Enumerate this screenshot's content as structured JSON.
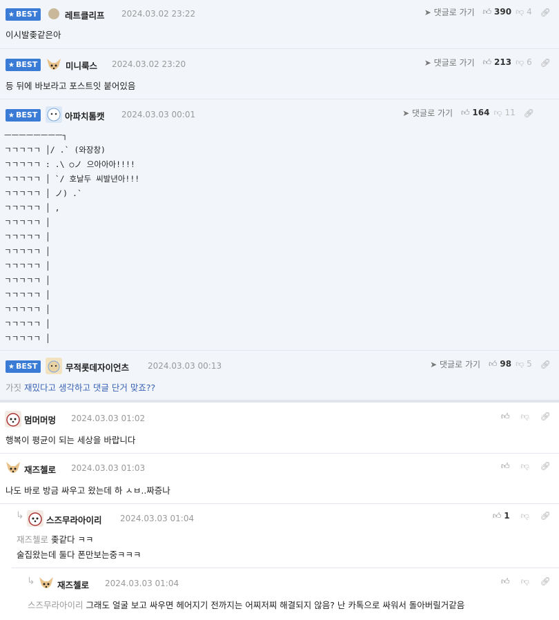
{
  "best_label": "BEST",
  "reply_link": "댓글로 가기",
  "best_comments": [
    {
      "nick": "레트클리프",
      "date": "2024.03.02 23:22",
      "up": "390",
      "down": "4",
      "text": "이시발좆같은아"
    },
    {
      "nick": "미니룩스",
      "date": "2024.03.02 23:20",
      "up": "213",
      "down": "6",
      "text": "등 뒤에 바보라고 포스트잇 붙어있음"
    },
    {
      "nick": "아파치톰캣",
      "date": "2024.03.03 00:01",
      "up": "164",
      "down": "11",
      "art": "ㅡㅡㅡㅡㅡㅡㅡㅡ┐\nㄱㄱㄱㄱㄱ │/ .` (와장창)\nㄱㄱㄱㄱㄱ : .\\ ○ノ 으아아아!!!!\nㄱㄱㄱㄱㄱ │ `/ 호날두 씨발년아!!!\nㄱㄱㄱㄱㄱ │ ノ) .`\nㄱㄱㄱㄱㄱ │ ,\nㄱㄱㄱㄱㄱ │\nㄱㄱㄱㄱㄱ │\nㄱㄱㄱㄱㄱ │\nㄱㄱㄱㄱㄱ │\nㄱㄱㄱㄱㄱ │\nㄱㄱㄱㄱㄱ │\nㄱㄱㄱㄱㄱ │\nㄱㄱㄱㄱㄱ │\nㄱㄱㄱㄱㄱ │"
    },
    {
      "nick": "무적롯데자이언츠",
      "date": "2024.03.03 00:13",
      "up": "98",
      "down": "5",
      "prefix": "가짓",
      "text": " 재밌다고 생각하고 댓글 단거 맞죠??"
    }
  ],
  "comments": [
    {
      "nick": "멈머머멍",
      "date": "2024.03.03 01:02",
      "text": "행복이 평균이 되는 세상을 바랍니다"
    },
    {
      "nick": "재즈첼로",
      "date": "2024.03.03 01:03",
      "text": "나도 바로 방금 싸우고 왔는데 하 ㅅㅂ..짜증나"
    },
    {
      "nick": "스즈무라아이리",
      "date": "2024.03.03 01:04",
      "up": "1",
      "mention": "재즈첼로",
      "line1": " 좆같다 ㅋㅋ",
      "line2": "술집왔는데 둘다 폰만보는중ㅋㅋㅋ"
    },
    {
      "nick": "재즈첼로",
      "date": "2024.03.03 01:04",
      "mention": "스즈무라아이리",
      "text": " 그래도 얼굴 보고 싸우면 헤어지기 전까지는 어찌저찌 해결되지 않음? 난 카톡으로 싸워서 돌아버릴거같음"
    }
  ]
}
